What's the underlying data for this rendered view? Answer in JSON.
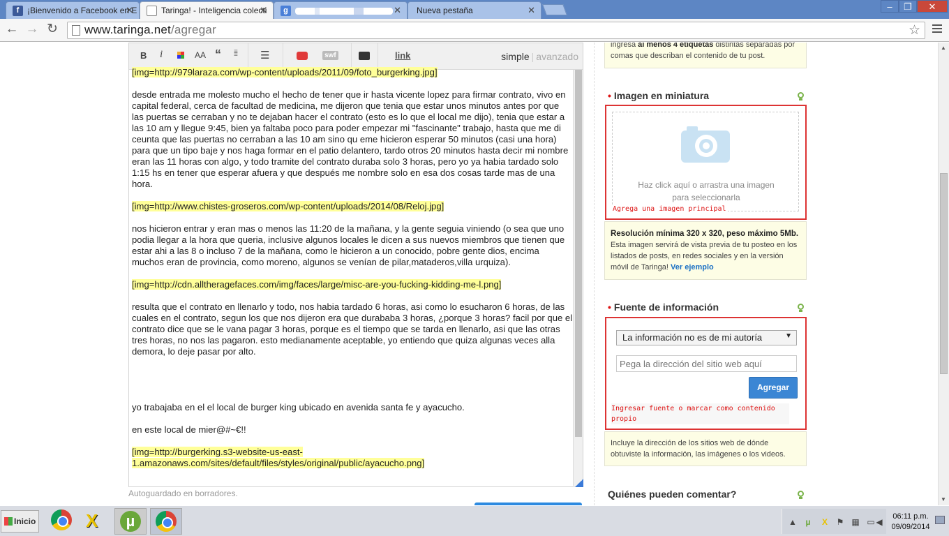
{
  "browser": {
    "tabs": [
      {
        "title": "¡Bienvenido a Facebook en E",
        "icon": "facebook-icon"
      },
      {
        "title": "Taringa! - Inteligencia colecti",
        "icon": "taringa-icon"
      },
      {
        "title": "",
        "icon": "google-icon"
      },
      {
        "title": "Nueva pestaña",
        "icon": ""
      }
    ],
    "url": {
      "host": "www.taringa.net",
      "path": "/agregar"
    }
  },
  "editor": {
    "toolbar": {
      "bold": "B",
      "italic": "i",
      "size": "AA",
      "quote": "“",
      "swf": "swf",
      "link": "link",
      "simple": "simple",
      "separator": "|",
      "advanced": "avanzado"
    },
    "paragraphs": [
      {
        "text": "[img=http://979laraza.com/wp-content/uploads/2011/09/foto_burgerking.jpg]",
        "img": true
      },
      {
        "text": "desde entrada me molesto mucho el hecho de tener que ir hasta vicente lopez para firmar contrato, vivo en capital federal, cerca de facultad de medicina, me dijeron que tenia que estar unos minutos antes por que las puertas se cerraban y no te dejaban hacer el contrato (esto es lo que el local me dijo), tenia que estar a las 10 am y llegue 9:45, bien ya faltaba poco para poder empezar mi \"fascinante\" trabajo, hasta que me di ceunta que las puertas no cerraban a las 10 am sino qu eme hicieron esperar 50 minutos (casi una hora) para que un tipo baje y nos haga formar en el patio delantero, tardo otros 20 minutos hasta decir mi nombre eran las 11 horas con algo, y todo tramite del contrato duraba solo 3 horas, pero yo ya habia tardado solo 1:15 hs en tener que esperar afuera y que después me nombre solo en esa dos cosas tarde mas de una hora.",
        "img": false
      },
      {
        "text": "[img=http://www.chistes-groseros.com/wp-content/uploads/2014/08/Reloj.jpg]",
        "img": true
      },
      {
        "text": "nos hicieron entrar y eran mas o menos las 11:20 de la mañana, y la gente seguia viniendo (o sea que uno podia llegar a la hora que queria, inclusive algunos locales le dicen a sus nuevos miembros que tienen que estar ahi a las 8 o incluso 7 de la mañana, como le hicieron a un conocido, pobre gente dios, encima muchos eran de provincia, como moreno, algunos se venían de pilar,mataderos,villa urquiza).",
        "img": false
      },
      {
        "text": "[img=http://cdn.alltheragefaces.com/img/faces/large/misc-are-you-fucking-kidding-me-l.png]",
        "img": true
      },
      {
        "text": "resulta que el contrato en llenarlo y todo, nos habia tardado 6 horas, asi como lo esucharon 6 horas, de las cuales en el contrato, segun los que  nos dijeron era que durababa 3 horas, ¿porque 3 horas? facil por que el contrato dice que se le vana pagar 3 horas, porque es el tiempo que se tarda en llenarlo, asi que las otras tres horas, no nos las pagaron. esto medianamente aceptable, yo entiendo que quiza algunas veces alla demora, lo deje pasar por alto.",
        "img": false
      },
      {
        "text": "",
        "img": false,
        "gap": true
      },
      {
        "text": "yo trabajaba en el el local de burger king ubicado en avenida santa fe y ayacucho.",
        "img": false
      },
      {
        "text": "en este local de mier@#~€!!",
        "img": false
      },
      {
        "text": "[img=http://burgerking.s3-website-us-east-1.amazonaws.com/sites/default/files/styles/original/public/ayacucho.png]",
        "img": true
      }
    ],
    "autosave": "Autoguardado en borradores."
  },
  "sidebar": {
    "tags_hint_pre": "ingresá ",
    "tags_hint_bold": "al menos 4 etiquetas",
    "tags_hint_post": " distintas separadas por comas que describan el contenido de tu post.",
    "thumbnail": {
      "title": "Imagen en miniatura",
      "drop_line1": "Haz click aquí o arrastra una imagen",
      "drop_line2": "para seleccionarla",
      "error": "Agrega una imagen principal",
      "hint_bold": "Resolución mínima 320 x 320, peso máximo 5Mb.",
      "hint_text": "Esta imagen servirá de vista previa de tu posteo en los listados de posts, en redes sociales y en la versión móvil de Taringa!",
      "hint_link": "Ver ejemplo"
    },
    "source": {
      "title": "Fuente de información",
      "select_value": "La información no es de mi autoría",
      "input_placeholder": "Pega la dirección del sitio web aquí",
      "button": "Agregar",
      "error": "Ingresar fuente o marcar como contenido propio",
      "hint": "Incluye la dirección de los sitios web de dónde obtuviste la información, las imágenes o los videos."
    },
    "comments_title": "Quiénes pueden comentar?"
  },
  "taskbar": {
    "start": "Inicio",
    "time": "06:11 p.m.",
    "date": "09/09/2014"
  },
  "colors": {
    "accent": "#3b86d4",
    "error": "#d33333",
    "highlight": "#ffff99",
    "chrome_tab": "#5d86c4"
  }
}
